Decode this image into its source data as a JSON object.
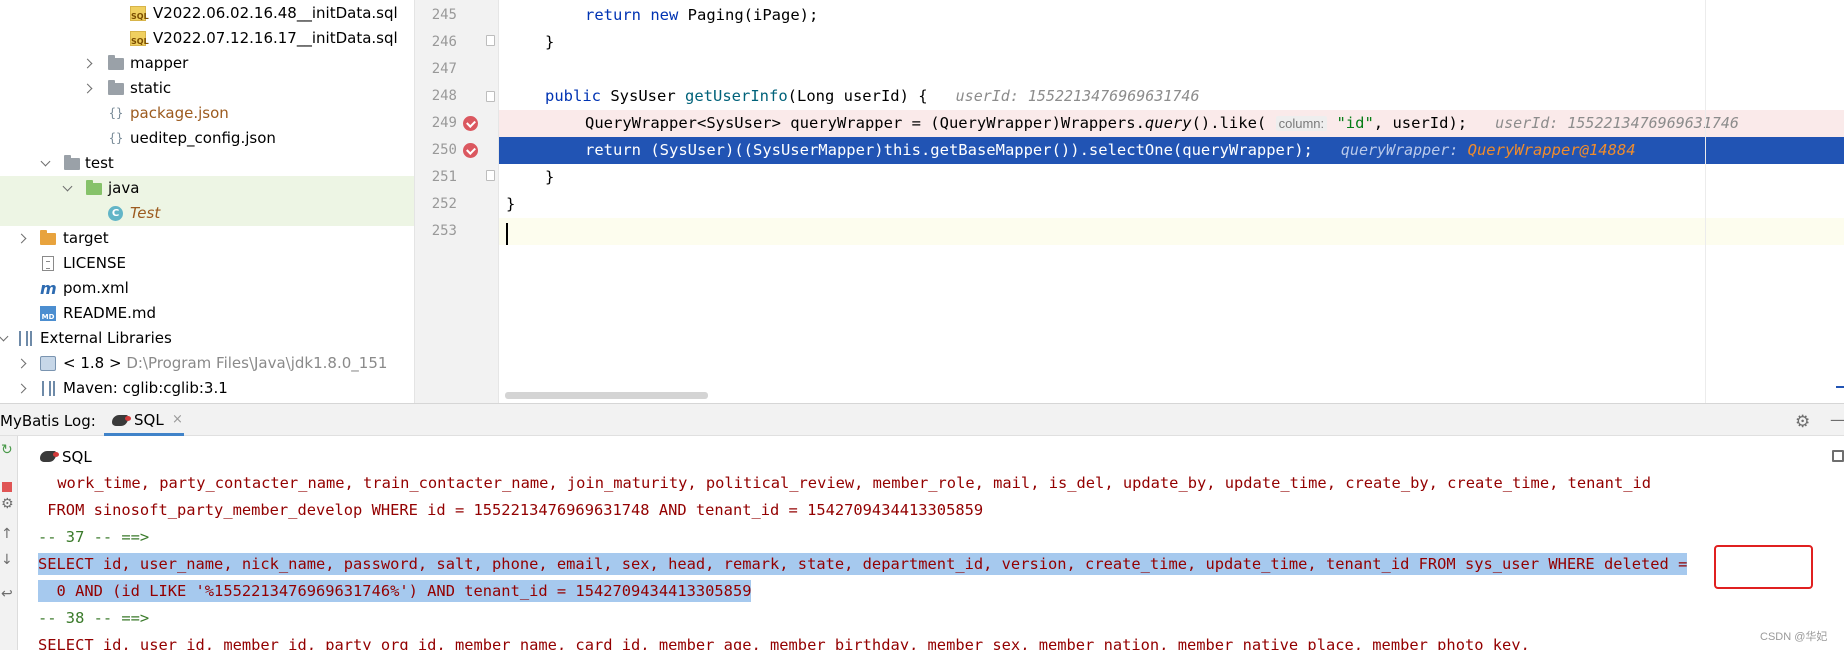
{
  "project_tree": {
    "items": [
      {
        "label": "V2022.06.02.16.48__initData.sql",
        "type": "sql"
      },
      {
        "label": "V2022.07.12.16.17__initData.sql",
        "type": "sql"
      },
      {
        "label": "mapper",
        "type": "folder"
      },
      {
        "label": "static",
        "type": "folder"
      },
      {
        "label": "package.json",
        "type": "json"
      },
      {
        "label": "ueditер_config.json",
        "type": "json"
      },
      {
        "label": "test",
        "type": "folder"
      },
      {
        "label": "java",
        "type": "folder-green"
      },
      {
        "label": "Test",
        "type": "class"
      },
      {
        "label": "target",
        "type": "folder-orange"
      },
      {
        "label": "LICENSE",
        "type": "file"
      },
      {
        "label": "pom.xml",
        "type": "maven"
      },
      {
        "label": "README.md",
        "type": "md"
      },
      {
        "label": "External Libraries",
        "type": "lib"
      },
      {
        "label": "< 1.8 >",
        "sub": "D:\\Program Files\\Java\\jdk1.8.0_151",
        "type": "jdk"
      },
      {
        "label": "Maven: cglib:cglib:3.1",
        "type": "lib"
      }
    ]
  },
  "editor": {
    "line_numbers": [
      "245",
      "246",
      "247",
      "248",
      "249",
      "250",
      "251",
      "252",
      "253"
    ],
    "lines": {
      "l245": {
        "kw1": "return",
        "kw2": "new",
        "rest": " Paging(iPage);"
      },
      "l246": {
        "text": "}"
      },
      "l248": {
        "kw": "public",
        "type": " SysUser ",
        "fn": "getUserInfo",
        "params": "(Long userId) {",
        "hint": "userId: 1552213476969631746"
      },
      "l249": {
        "a": "QueryWrapper<SysUser> queryWrapper = (QueryWrapper)Wrappers.",
        "method": "query",
        "b": "().like(",
        "param_hint": "column:",
        "str": "\"id\"",
        "c": ", userId);",
        "hint": "userId: 1552213476969631746"
      },
      "l250": {
        "kw": "return",
        "rest": " (SysUser)((SysUserMapper)this.getBaseMapper()).selectOne(queryWrapper);",
        "hint_label": "queryWrapper:",
        "hint_value": "QueryWrapper@14884"
      },
      "l251": {
        "text": "}"
      },
      "l252": {
        "text": "}"
      }
    }
  },
  "toolwindow": {
    "title": "MyBatis Log:",
    "tab_label": "SQL",
    "tab_close": "×",
    "sub_label": "SQL"
  },
  "log": {
    "lines": [
      " work_time, party_contacter_name, train_contacter_name, join_maturity, political_review, member_role, mail, is_del, update_by, update_time, create_by, create_time, tenant_id",
      " FROM sinosoft_party_member_develop WHERE id = 1552213476969631748 AND tenant_id = 1542709434413305859",
      "-- 37 -- ==>",
      "SELECT id, user_name, nick_name, password, salt, phone, email, sex, head, remark, state, department_id, version, create_time, update_time, tenant_id FROM sys_user WHERE deleted =",
      "  0 AND (id LIKE '%1552213476969631746%') AND tenant_id = 1542709434413305859",
      "-- 38 -- ==>",
      "SELECT id, user_id, member_id, party_org_id, member_name, card_id, member_age, member_birthday, member_sex, member_nation, member_native_place, member_photo_key,"
    ]
  },
  "watermark": "CSDN @华妃",
  "colors": {
    "exec_line": "#2154b4",
    "breakpoint": "#db5860",
    "sql_text": "#930000",
    "selection": "#a6c9ee",
    "highlight_box": "#e02020"
  }
}
